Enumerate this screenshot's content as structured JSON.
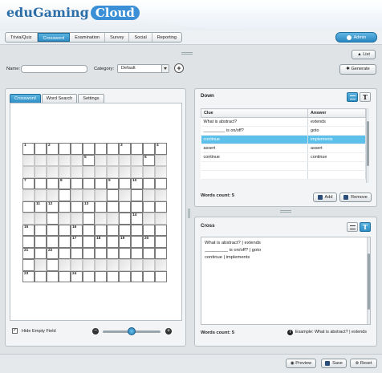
{
  "app": {
    "logo_main": "eduGaming",
    "logo_cloud": "Cloud",
    "user_label": "Admin"
  },
  "nav": {
    "tabs": [
      "Trivia/Quiz",
      "Crossword",
      "Examination",
      "Survey",
      "Social",
      "Reporting"
    ],
    "active": "Crossword"
  },
  "toolbar": {
    "list_label": "List",
    "generate_label": "Generate"
  },
  "form": {
    "name_label": "Name:",
    "name_value": "",
    "category_label": "Category:",
    "category_value": "Default"
  },
  "editor": {
    "tabs": [
      "Crossword",
      "Word Search",
      "Settings"
    ],
    "active_tab": "Crossword",
    "hide_empty_label": "Hide Empty Field",
    "hide_empty_checked": true,
    "zoom_level": 0.5,
    "grid_numbers": {
      "0-0": "1",
      "0-2": "2",
      "0-8": "3",
      "0-11": "4",
      "1-5": "5",
      "1-10": "6",
      "3-0": "7",
      "3-3": "8",
      "3-7": "9",
      "3-9": "10",
      "5-1": "11",
      "5-2": "12",
      "5-5": "13",
      "6-9": "14",
      "7-0": "15",
      "7-4": "16",
      "8-4": "17",
      "8-6": "18",
      "8-8": "19",
      "8-10": "20",
      "9-0": "21",
      "9-2": "22",
      "11-0": "23",
      "11-4": "24"
    }
  },
  "down": {
    "title": "Down",
    "columns": [
      "Clue",
      "Answer"
    ],
    "rows": [
      {
        "clue": "What is abstract?",
        "answer": "extends"
      },
      {
        "clue": "_________ is on/off?",
        "answer": "goto"
      },
      {
        "clue": "continue",
        "answer": "implements"
      },
      {
        "clue": "assert",
        "answer": "assert"
      },
      {
        "clue": "continue",
        "answer": "continue"
      }
    ],
    "selected_index": 2,
    "words_count_label": "Words count: 5",
    "add_label": "Add",
    "remove_label": "Remove"
  },
  "cross": {
    "title": "Cross",
    "lines": [
      "What is abstract? | extends",
      "_________ is on/off? | goto",
      "continue | implements"
    ],
    "words_count_label": "Words count: 5",
    "example_text": "Example: What is abstract? | extends"
  },
  "footer": {
    "preview_label": "Preview",
    "save_label": "Save",
    "reset_label": "Reset"
  },
  "colors": {
    "accent": "#2f8fc6",
    "selected_row": "#5cc0ea"
  }
}
